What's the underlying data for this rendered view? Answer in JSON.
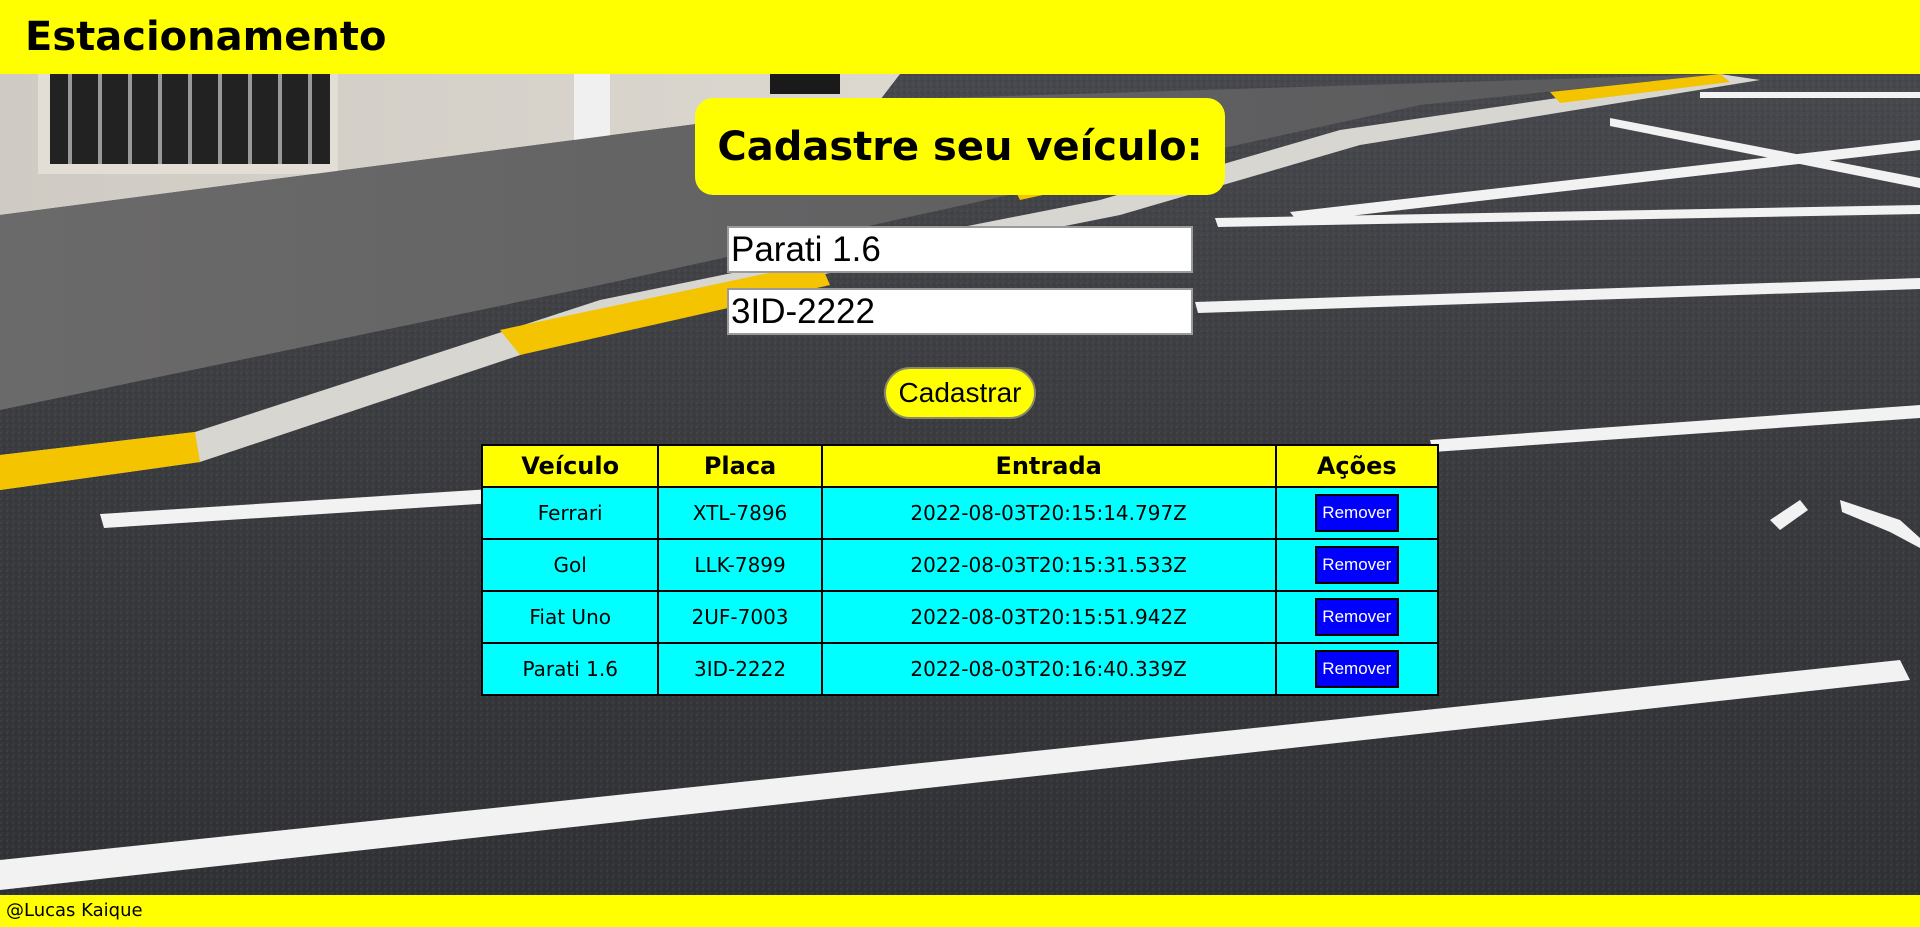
{
  "header": {
    "title": "Estacionamento"
  },
  "form": {
    "title": "Cadastre seu veículo:",
    "model_value": "Parati 1.6",
    "plate_value": "3ID-2222",
    "submit_label": "Cadastrar"
  },
  "table": {
    "headers": [
      "Veículo",
      "Placa",
      "Entrada",
      "Ações"
    ],
    "rows": [
      {
        "veiculo": "Ferrari",
        "placa": "XTL-7896",
        "entrada": "2022-08-03T20:15:14.797Z",
        "acao": "Remover"
      },
      {
        "veiculo": "Gol",
        "placa": "LLK-7899",
        "entrada": "2022-08-03T20:15:31.533Z",
        "acao": "Remover"
      },
      {
        "veiculo": "Fiat Uno",
        "placa": "2UF-7003",
        "entrada": "2022-08-03T20:15:51.942Z",
        "acao": "Remover"
      },
      {
        "veiculo": "Parati 1.6",
        "placa": "3ID-2222",
        "entrada": "2022-08-03T20:16:40.339Z",
        "acao": "Remover"
      }
    ]
  },
  "footer": {
    "credit": "@Lucas Kaique"
  },
  "colors": {
    "header_yellow": "#ffff00",
    "table_cell_cyan": "#00ffff",
    "remove_button_blue": "#0000ff"
  },
  "background": {
    "image_subject": "parking-lot-asphalt-photo"
  }
}
